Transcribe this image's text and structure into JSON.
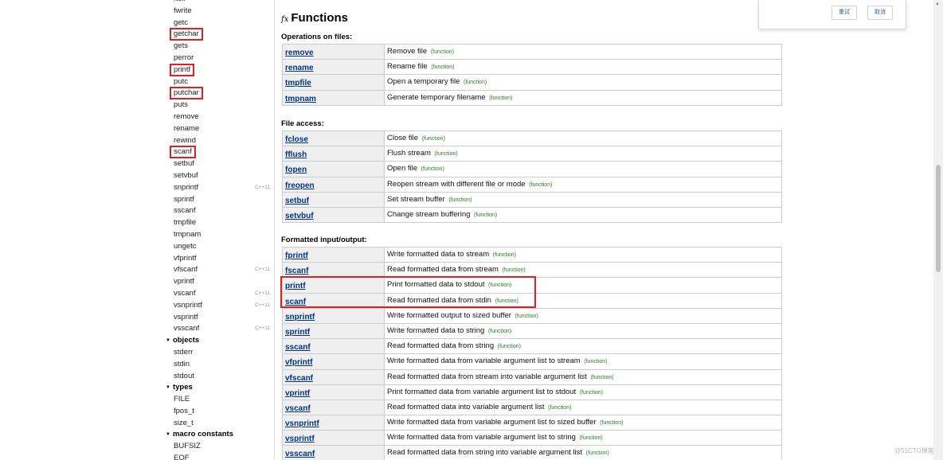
{
  "sidebar": {
    "items": [
      {
        "name": "ftell",
        "type": "item",
        "tag": "",
        "highlight": false
      },
      {
        "name": "fwrite",
        "type": "item",
        "tag": "",
        "highlight": false
      },
      {
        "name": "getc",
        "type": "item",
        "tag": "",
        "highlight": false
      },
      {
        "name": "getchar",
        "type": "item",
        "tag": "",
        "highlight": true
      },
      {
        "name": "gets",
        "type": "item",
        "tag": "",
        "highlight": false
      },
      {
        "name": "perror",
        "type": "item",
        "tag": "",
        "highlight": false
      },
      {
        "name": "printf",
        "type": "item",
        "tag": "",
        "highlight": true
      },
      {
        "name": "putc",
        "type": "item",
        "tag": "",
        "highlight": false
      },
      {
        "name": "putchar",
        "type": "item",
        "tag": "",
        "highlight": true
      },
      {
        "name": "puts",
        "type": "item",
        "tag": "",
        "highlight": false
      },
      {
        "name": "remove",
        "type": "item",
        "tag": "",
        "highlight": false
      },
      {
        "name": "rename",
        "type": "item",
        "tag": "",
        "highlight": false
      },
      {
        "name": "rewind",
        "type": "item",
        "tag": "",
        "highlight": false
      },
      {
        "name": "scanf",
        "type": "item",
        "tag": "",
        "highlight": true
      },
      {
        "name": "setbuf",
        "type": "item",
        "tag": "",
        "highlight": false
      },
      {
        "name": "setvbuf",
        "type": "item",
        "tag": "",
        "highlight": false
      },
      {
        "name": "snprintf",
        "type": "item",
        "tag": "C++11",
        "highlight": false
      },
      {
        "name": "sprintf",
        "type": "item",
        "tag": "",
        "highlight": false
      },
      {
        "name": "sscanf",
        "type": "item",
        "tag": "",
        "highlight": false
      },
      {
        "name": "tmpfile",
        "type": "item",
        "tag": "",
        "highlight": false
      },
      {
        "name": "tmpnam",
        "type": "item",
        "tag": "",
        "highlight": false
      },
      {
        "name": "ungetc",
        "type": "item",
        "tag": "",
        "highlight": false
      },
      {
        "name": "vfprintf",
        "type": "item",
        "tag": "",
        "highlight": false
      },
      {
        "name": "vfscanf",
        "type": "item",
        "tag": "C++11",
        "highlight": false
      },
      {
        "name": "vprintf",
        "type": "item",
        "tag": "",
        "highlight": false
      },
      {
        "name": "vscanf",
        "type": "item",
        "tag": "C++11",
        "highlight": false
      },
      {
        "name": "vsnprintf",
        "type": "item",
        "tag": "C++11",
        "highlight": false
      },
      {
        "name": "vsprintf",
        "type": "item",
        "tag": "",
        "highlight": false
      },
      {
        "name": "vsscanf",
        "type": "item",
        "tag": "C++11",
        "highlight": false
      },
      {
        "name": "objects",
        "type": "section",
        "tag": "",
        "highlight": false
      },
      {
        "name": "stderr",
        "type": "item",
        "tag": "",
        "highlight": false
      },
      {
        "name": "stdin",
        "type": "item",
        "tag": "",
        "highlight": false
      },
      {
        "name": "stdout",
        "type": "item",
        "tag": "",
        "highlight": false
      },
      {
        "name": "types",
        "type": "section",
        "tag": "",
        "highlight": false
      },
      {
        "name": "FILE",
        "type": "item",
        "tag": "",
        "highlight": false
      },
      {
        "name": "fpos_t",
        "type": "item",
        "tag": "",
        "highlight": false
      },
      {
        "name": "size_t",
        "type": "item",
        "tag": "",
        "highlight": false
      },
      {
        "name": "macro constants",
        "type": "section",
        "tag": "",
        "highlight": false
      },
      {
        "name": "BUFSIZ",
        "type": "item",
        "tag": "",
        "highlight": false
      },
      {
        "name": "EOF",
        "type": "item",
        "tag": "",
        "highlight": false
      }
    ]
  },
  "main": {
    "title_icon": "fx",
    "title": "Functions",
    "groups": [
      {
        "label": "Operations on files:",
        "rows": [
          {
            "name": "remove",
            "desc": "Remove file",
            "kind": "(function)"
          },
          {
            "name": "rename",
            "desc": "Rename file",
            "kind": "(function)"
          },
          {
            "name": "tmpfile",
            "desc": "Open a temporary file",
            "kind": "(function)"
          },
          {
            "name": "tmpnam",
            "desc": "Generate temporary filename",
            "kind": "(function)"
          }
        ]
      },
      {
        "label": "File access:",
        "rows": [
          {
            "name": "fclose",
            "desc": "Close file",
            "kind": "(function)"
          },
          {
            "name": "fflush",
            "desc": "Flush stream",
            "kind": "(function)"
          },
          {
            "name": "fopen",
            "desc": "Open file",
            "kind": "(function)"
          },
          {
            "name": "freopen",
            "desc": "Reopen stream with different file or mode",
            "kind": "(function)"
          },
          {
            "name": "setbuf",
            "desc": "Set stream buffer",
            "kind": "(function)"
          },
          {
            "name": "setvbuf",
            "desc": "Change stream buffering",
            "kind": "(function)"
          }
        ]
      },
      {
        "label": "Formatted input/output:",
        "rows": [
          {
            "name": "fprintf",
            "desc": "Write formatted data to stream",
            "kind": "(function)"
          },
          {
            "name": "fscanf",
            "desc": "Read formatted data from stream",
            "kind": "(function)"
          },
          {
            "name": "printf",
            "desc": "Print formatted data to stdout",
            "kind": "(function)"
          },
          {
            "name": "scanf",
            "desc": "Read formatted data from stdin",
            "kind": "(function)"
          },
          {
            "name": "snprintf",
            "desc": "Write formatted output to sized buffer",
            "kind": "(function)"
          },
          {
            "name": "sprintf",
            "desc": "Write formatted data to string",
            "kind": "(function)"
          },
          {
            "name": "sscanf",
            "desc": "Read formatted data from string",
            "kind": "(function)"
          },
          {
            "name": "vfprintf",
            "desc": "Write formatted data from variable argument list to stream",
            "kind": "(function)"
          },
          {
            "name": "vfscanf",
            "desc": "Read formatted data from stream into variable argument list",
            "kind": "(function)"
          },
          {
            "name": "vprintf",
            "desc": "Print formatted data from variable argument list to stdout",
            "kind": "(function)"
          },
          {
            "name": "vscanf",
            "desc": "Read formatted data into variable argument list",
            "kind": "(function)"
          },
          {
            "name": "vsnprintf",
            "desc": "Write formatted data from variable argument list to sized buffer",
            "kind": "(function)"
          },
          {
            "name": "vsprintf",
            "desc": "Write formatted data from variable argument list to string",
            "kind": "(function)"
          },
          {
            "name": "vsscanf",
            "desc": "Read formatted data from string into variable argument list",
            "kind": "(function)"
          }
        ]
      }
    ]
  },
  "dialog": {
    "retry_label": "重试",
    "cancel_label": "取消"
  },
  "watermark": "@51CTO博客",
  "colors": {
    "link": "#00337f",
    "highlight_box": "#e02020",
    "kind_text": "#2a7a2a",
    "name_cell_bg": "#efefef"
  }
}
